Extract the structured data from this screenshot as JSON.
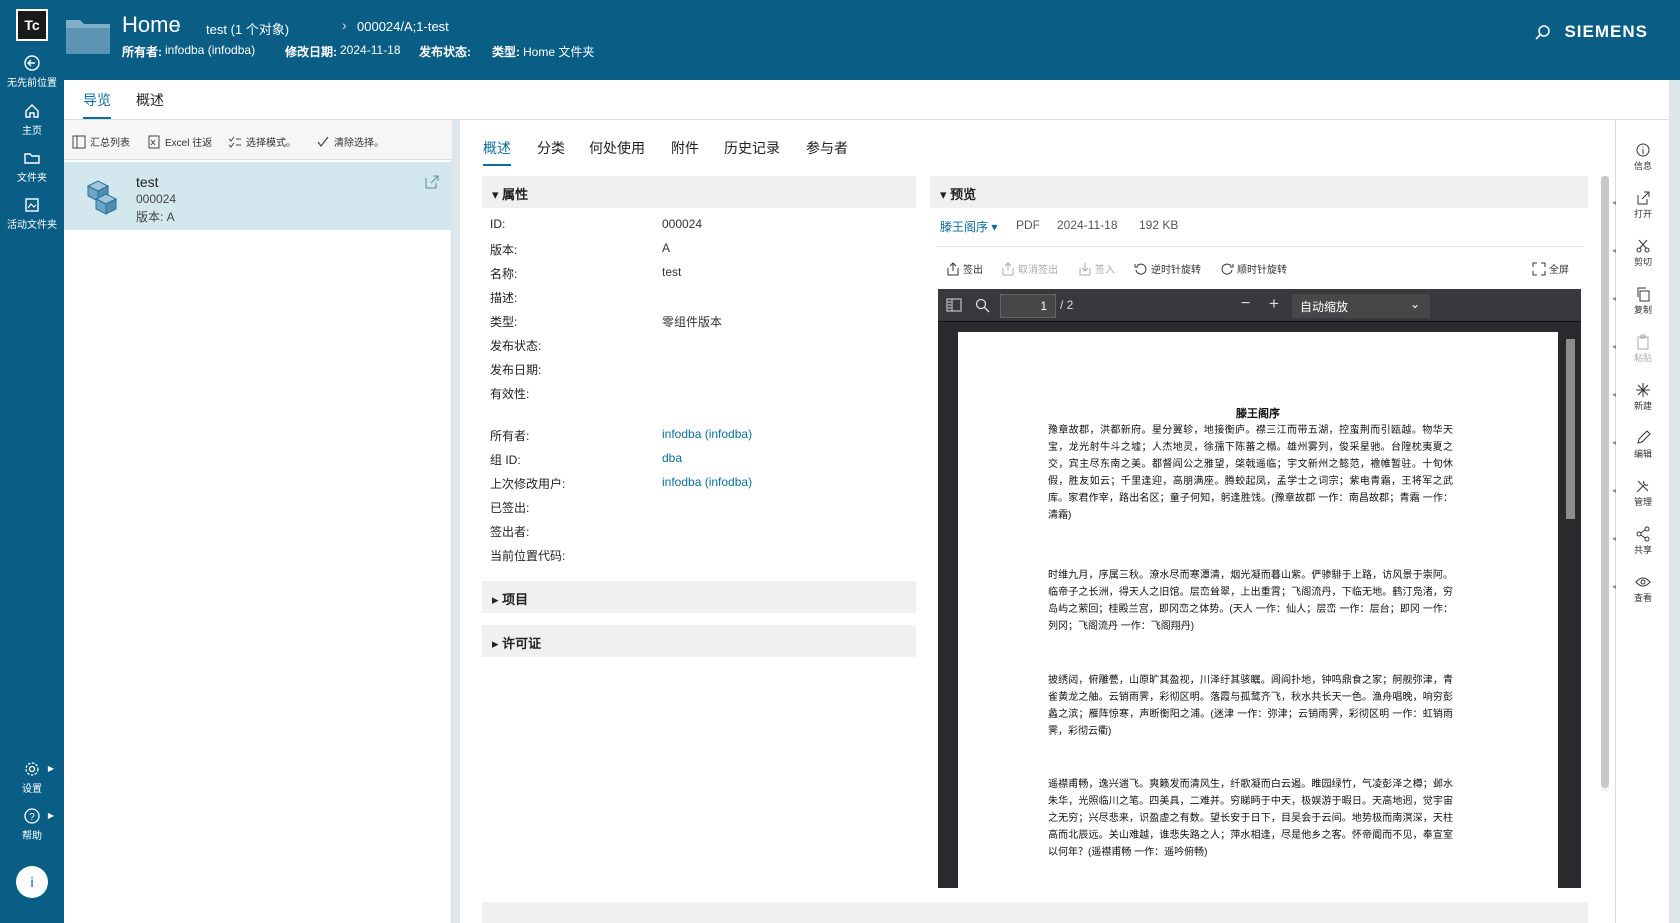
{
  "app": {
    "logo": "Tc",
    "brand": "SIEMENS"
  },
  "leftnav": {
    "items": [
      {
        "label": "无先前位置"
      },
      {
        "label": "主页"
      },
      {
        "label": "文件夹"
      },
      {
        "label": "活动文件夹"
      }
    ],
    "bottom": [
      {
        "label": "设置"
      },
      {
        "label": "帮助"
      }
    ],
    "info": "i"
  },
  "header": {
    "title": "Home",
    "breadcrumb": [
      "test (1 个对象)",
      "000024/A;1-test"
    ],
    "owner_label": "所有者:",
    "owner_value": "infodba (infodba)",
    "modified_label": "修改日期:",
    "modified_value": "2024-11-18",
    "release_label": "发布状态:",
    "type_label": "类型:",
    "type_value": "Home 文件夹"
  },
  "top_tabs": [
    "导览",
    "概述"
  ],
  "left_panel": {
    "toolbar": [
      "汇总列表",
      "Excel 往返",
      "选择模式。",
      "清除选择。"
    ],
    "item": {
      "name": "test",
      "id": "000024",
      "rev": "版本:  A"
    }
  },
  "sub_tabs": [
    "概述",
    "分类",
    "何处使用",
    "附件",
    "历史记录",
    "参与者"
  ],
  "properties": {
    "header": "属性",
    "rows": [
      {
        "label": "ID:",
        "value": "000024",
        "link": false
      },
      {
        "label": "版本:",
        "value": "A",
        "link": false
      },
      {
        "label": "名称:",
        "value": "test",
        "link": false
      },
      {
        "label": "描述:",
        "value": "",
        "link": false
      },
      {
        "label": "类型:",
        "value": "零组件版本",
        "link": false
      },
      {
        "label": "发布状态:",
        "value": "",
        "link": false
      },
      {
        "label": "发布日期:",
        "value": "",
        "link": false
      },
      {
        "label": "有效性:",
        "value": "",
        "link": false
      },
      {
        "label": "所有者:",
        "value": "infodba (infodba)",
        "link": true
      },
      {
        "label": "组 ID:",
        "value": "dba",
        "link": true
      },
      {
        "label": "上次修改用户:",
        "value": "infodba (infodba)",
        "link": true
      },
      {
        "label": "已签出:",
        "value": "",
        "link": false
      },
      {
        "label": "签出者:",
        "value": "",
        "link": false
      },
      {
        "label": "当前位置代码:",
        "value": "",
        "link": false
      }
    ]
  },
  "sections": [
    "项目",
    "许可证"
  ],
  "preview": {
    "header": "预览",
    "file_name": "滕王阁序",
    "file_type": "PDF",
    "file_date": "2024-11-18",
    "file_size": "192 KB",
    "tools": [
      "签出",
      "取消签出",
      "签入",
      "逆时针旋转",
      "顺时针旋转",
      "全屏"
    ],
    "page_current": "1",
    "page_total": "/ 2",
    "zoom": "自动缩放",
    "doc_title": "滕王阁序",
    "paragraphs": [
      "豫章故郡，洪都新府。星分翼轸，地接衡庐。襟三江而带五湖，控蛮荆而引瓯越。物华天宝，龙光射牛斗之墟；人杰地灵，徐孺下陈蕃之榻。雄州雾列，俊采星驰。台隍枕夷夏之交，宾主尽东南之美。都督阎公之雅望，棨戟遥临；宇文新州之懿范，襜帷暂驻。十旬休假，胜友如云；千里逢迎，高朋满座。腾蛟起凤，孟学士之词宗；紫电青霜，王将军之武库。家君作宰，路出名区；童子何知，躬逢胜饯。(豫章故郡 一作：南昌故郡；青霜 一作：清霜)",
      "时维九月，序属三秋。潦水尽而寒潭清，烟光凝而暮山紫。俨骖騑于上路，访风景于崇阿。临帝子之长洲，得天人之旧馆。层峦耸翠，上出重霄；飞阁流丹，下临无地。鹤汀凫渚，穷岛屿之萦回；桂殿兰宫，即冈峦之体势。(天人 一作：仙人；层峦 一作：层台；即冈 一作：列冈；飞阁流丹 一作：飞阁翔丹)",
      "披绣闼，俯雕甍，山原旷其盈视，川泽纡其骇瞩。闾阎扑地，钟鸣鼎食之家；舸舰弥津，青雀黄龙之舳。云销雨霁，彩彻区明。落霞与孤鹜齐飞，秋水共长天一色。渔舟唱晚，响穷彭蠡之滨；雁阵惊寒，声断衡阳之浦。(迷津 一作：弥津；云销雨霁，彩彻区明 一作：虹销雨霁，彩彻云衢)",
      "遥襟甫畅，逸兴遄飞。爽籁发而清风生，纤歌凝而白云遏。睢园绿竹，气凌彭泽之樽；邺水朱华，光照临川之笔。四美具，二难并。穷睇眄于中天，极娱游于暇日。天高地迥，觉宇宙之无穷；兴尽悲来，识盈虚之有数。望长安于日下，目吴会于云间。地势极而南溟深，天柱高而北辰远。关山难越，谁悲失路之人；萍水相逢，尽是他乡之客。怀帝阍而不见，奉宣室以何年？(遥襟甫畅 一作：遥吟俯畅)"
    ]
  },
  "right_rail": [
    {
      "label": "信息",
      "icon": "info-icon",
      "enabled": true
    },
    {
      "label": "打开",
      "icon": "open-icon",
      "enabled": true
    },
    {
      "label": "剪切",
      "icon": "scissors-icon",
      "enabled": true
    },
    {
      "label": "复制",
      "icon": "copy-icon",
      "enabled": true
    },
    {
      "label": "粘贴",
      "icon": "paste-icon",
      "enabled": false
    },
    {
      "label": "新建",
      "icon": "new-icon",
      "enabled": true
    },
    {
      "label": "编辑",
      "icon": "pencil-icon",
      "enabled": true
    },
    {
      "label": "管理",
      "icon": "tools-icon",
      "enabled": true
    },
    {
      "label": "共享",
      "icon": "share-icon",
      "enabled": true
    },
    {
      "label": "查看",
      "icon": "eye-icon",
      "enabled": true
    }
  ],
  "colors": {
    "brand_bg": "#0a5e86",
    "accent": "#0a6e9c",
    "selected_row": "#d2e7ee"
  }
}
